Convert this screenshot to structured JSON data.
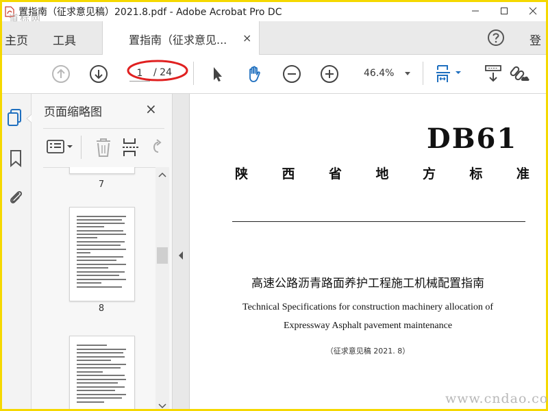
{
  "window": {
    "title": "置指南（征求意见稿）2021.8.pdf - Adobe Acrobat Pro DC",
    "watermark_top": "道标网",
    "watermark_bottom": "www.cndao.com"
  },
  "menu": {
    "home": "主页",
    "tools": "工具",
    "login": "登"
  },
  "tab": {
    "label": "置指南（征求意见...",
    "close": "×"
  },
  "toolbar": {
    "current_page": "1",
    "page_total": "/ 24",
    "zoom": "46.4%"
  },
  "thumbnail_panel": {
    "title": "页面缩略图",
    "close": "×",
    "pages": [
      {
        "label": "7"
      },
      {
        "label": "8"
      }
    ]
  },
  "document": {
    "code": "DB61",
    "standard_chars": [
      "陕",
      "西",
      "省",
      "地",
      "方",
      "标",
      "准"
    ],
    "title_cn": "高速公路沥青路面养护工程施工机械配置指南",
    "title_en_line1": "Technical Specifications for construction machinery allocation of",
    "title_en_line2": "Expressway Asphalt pavement maintenance",
    "draft_note": "（征求意见稿 2021. 8）"
  },
  "colors": {
    "frame_border": "#f5d800",
    "accent_blue": "#1e6fbf",
    "annotation_red": "#e02020"
  }
}
